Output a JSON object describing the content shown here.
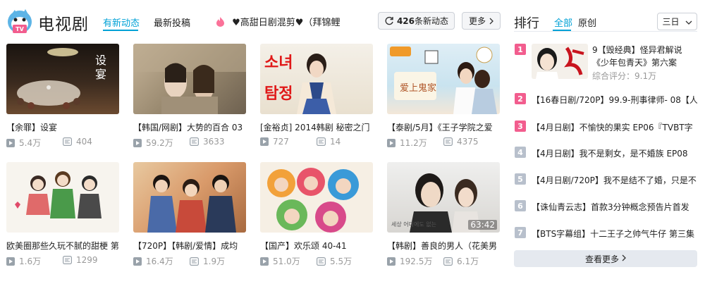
{
  "header": {
    "title": "电视剧",
    "tabs": [
      {
        "label": "有新动态",
        "active": true
      },
      {
        "label": "最新投稿",
        "active": false
      }
    ],
    "notice": "♥高甜日剧混剪♥（拜锦鲤",
    "updates_count": "426",
    "updates_suffix": "条新动态",
    "more_label": "更多"
  },
  "cards": [
    {
      "title": "【余罪】设宴",
      "plays": "5.4万",
      "danmaku": "404",
      "duration": "",
      "thumb_text": "设宴"
    },
    {
      "title": "【韩国/网剧】大势的百合 03",
      "plays": "59.2万",
      "danmaku": "3633",
      "duration": "",
      "thumb_text": ""
    },
    {
      "title": "[金裕贞] 2014韩剧 秘密之门",
      "plays": "727",
      "danmaku": "14",
      "duration": "",
      "thumb_text": "소녀 탐정"
    },
    {
      "title": "【泰剧/5月】《王子学院之爱",
      "plays": "11.2万",
      "danmaku": "4375",
      "duration": "",
      "thumb_text": "爱上鬼家"
    },
    {
      "title": "欧美圈那些久玩不腻的甜梗 第",
      "plays": "1.6万",
      "danmaku": "1299",
      "duration": "",
      "thumb_text": ""
    },
    {
      "title": "【720P】【韩剧/爱情】成均",
      "plays": "16.4万",
      "danmaku": "1.9万",
      "duration": "",
      "thumb_text": ""
    },
    {
      "title": "【国产】欢乐颂 40-41",
      "plays": "51.0万",
      "danmaku": "5.5万",
      "duration": "",
      "thumb_text": ""
    },
    {
      "title": "【韩剧】善良的男人（花美男",
      "plays": "192.5万",
      "danmaku": "6.1万",
      "duration": "63:42",
      "thumb_text": "세상 어디에도 없는"
    }
  ],
  "ranking": {
    "title": "排行",
    "tabs": [
      {
        "label": "全部",
        "active": true
      },
      {
        "label": "原创",
        "active": false
      }
    ],
    "period": "三日",
    "top": {
      "rank": "1",
      "title": "9【毁经典】怪异君解说《少年包青天》第六案",
      "score": "综合评分：9.1万"
    },
    "items": [
      {
        "rank": "2",
        "title": "【16春日剧/720P】99.9-刑事律师- 08【人"
      },
      {
        "rank": "3",
        "title": "【4月日剧】不愉快的果实 EP06『TVBT字"
      },
      {
        "rank": "4",
        "title": "【4月日剧】我不是剩女，是不婚族 EP08"
      },
      {
        "rank": "5",
        "title": "【4月日剧/720P】我不是结不了婚，只是不"
      },
      {
        "rank": "6",
        "title": "【诛仙青云志】首款3分钟概念预告片首发"
      },
      {
        "rank": "7",
        "title": "【BTS字幕组】十二王子之帅气牛仔 第三集"
      }
    ],
    "view_more": "查看更多"
  },
  "colors": {
    "accent": "#00a1d6",
    "pink": "#f25d8e",
    "rank_gray": "#b8c0cc"
  }
}
